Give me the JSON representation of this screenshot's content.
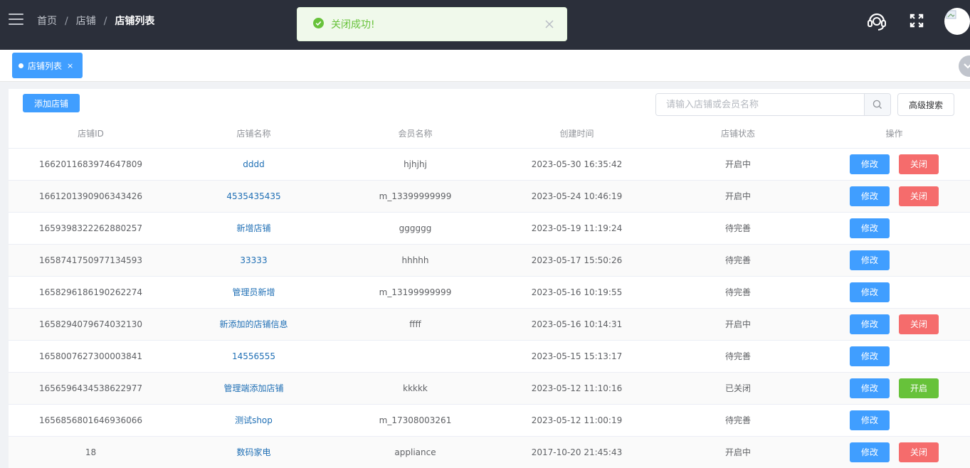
{
  "header": {
    "breadcrumb": [
      "首页",
      "店铺",
      "店铺列表"
    ]
  },
  "toast": {
    "message": "关闭成功!",
    "status": "success"
  },
  "tabs": [
    {
      "label": "店铺列表",
      "active": true
    }
  ],
  "toolbar": {
    "add_label": "添加店铺",
    "search_placeholder": "请输入店铺或会员名称",
    "advanced_label": "高级搜索"
  },
  "table": {
    "columns": [
      "店铺ID",
      "店铺名称",
      "会员名称",
      "创建时间",
      "店铺状态",
      "操作"
    ],
    "edit_label": "修改",
    "close_label": "关闭",
    "open_label": "开启",
    "rows": [
      {
        "id": "1662011683974647809",
        "name": "dddd",
        "member": "hjhjhj",
        "created": "2023-05-30 16:35:42",
        "status": "开启中",
        "action": "close"
      },
      {
        "id": "1661201390906343426",
        "name": "4535435435",
        "member": "m_13399999999",
        "created": "2023-05-24 10:46:19",
        "status": "开启中",
        "action": "close"
      },
      {
        "id": "1659398322262880257",
        "name": "新增店铺",
        "member": "gggggg",
        "created": "2023-05-19 11:19:24",
        "status": "待完善",
        "action": ""
      },
      {
        "id": "1658741750977134593",
        "name": "33333",
        "member": "hhhhh",
        "created": "2023-05-17 15:50:26",
        "status": "待完善",
        "action": ""
      },
      {
        "id": "1658296186190262274",
        "name": "管理员新增",
        "member": "m_13199999999",
        "created": "2023-05-16 10:19:55",
        "status": "待完善",
        "action": ""
      },
      {
        "id": "1658294079674032130",
        "name": "新添加的店铺信息",
        "member": "ffff",
        "created": "2023-05-16 10:14:31",
        "status": "开启中",
        "action": "close"
      },
      {
        "id": "1658007627300003841",
        "name": "14556555",
        "member": "",
        "created": "2023-05-15 15:13:17",
        "status": "待完善",
        "action": ""
      },
      {
        "id": "1656596434538622977",
        "name": "管理端添加店铺",
        "member": "kkkkk",
        "created": "2023-05-12 11:10:16",
        "status": "已关闭",
        "action": "open"
      },
      {
        "id": "1656856801646936066",
        "name": "测试shop",
        "member": "m_17308003261",
        "created": "2023-05-12 11:00:19",
        "status": "待完善",
        "action": ""
      },
      {
        "id": "18",
        "name": "数码家电",
        "member": "appliance",
        "created": "2017-10-20 21:45:43",
        "status": "开启中",
        "action": "close"
      }
    ]
  },
  "colors": {
    "header_bg": "#2b2f3a",
    "primary": "#409eff",
    "danger": "#f56c6c",
    "success": "#67c23a"
  },
  "icons": [
    "menu-icon",
    "headset-icon",
    "fullscreen-icon",
    "success-icon",
    "close-icon",
    "search-icon"
  ]
}
